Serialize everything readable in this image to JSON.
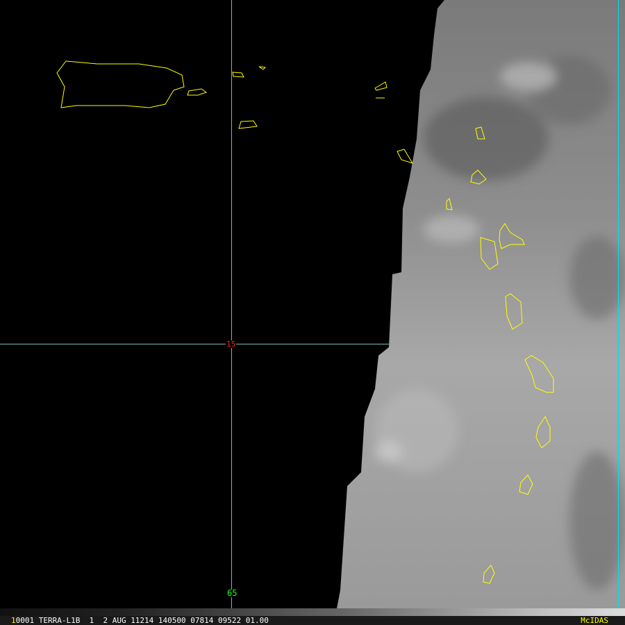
{
  "image": {
    "grid": {
      "lat_label": "15",
      "lon_label": "65"
    },
    "colors": {
      "coastline": "#ffff00",
      "grid": "#9fe6ea",
      "lat_label": "#ff2020",
      "lon_label": "#20ff20",
      "status_accent": "#ffff00"
    }
  },
  "status_bar": {
    "frame": "1",
    "text": "0001 TERRA-L1B  1  2 AUG 11214 140500 07814 09522 01.00",
    "brand": "McIDAS"
  }
}
